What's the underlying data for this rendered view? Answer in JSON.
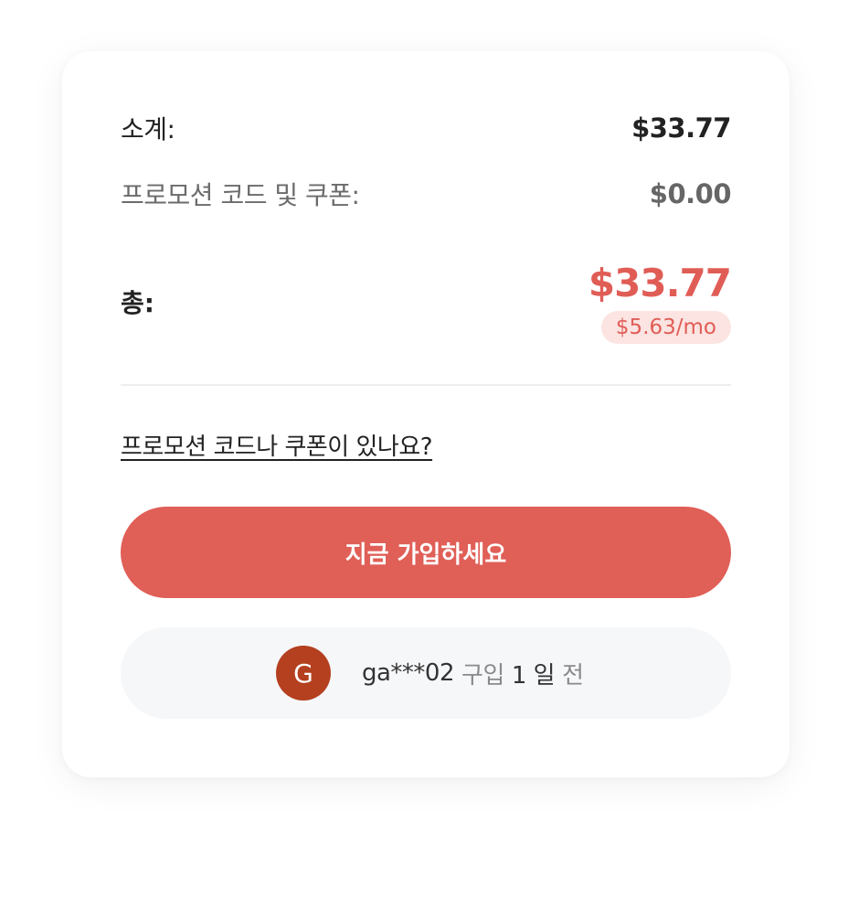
{
  "summary": {
    "subtotal_label": "소계:",
    "subtotal_value": "$33.77",
    "promo_label": "프로모션 코드 및 쿠폰:",
    "promo_value": "$0.00",
    "total_label": "총:",
    "total_value": "$33.77",
    "monthly_value": "$5.63/mo"
  },
  "promo_link": "프로모션 코드나 쿠폰이 있나요?",
  "signup_button": "지금 가입하세요",
  "recent_purchase": {
    "avatar_letter": "G",
    "user": "ga***02",
    "verb": "구입",
    "time_value": "1 일",
    "time_suffix": "전"
  },
  "colors": {
    "accent": "#e05f57",
    "avatar": "#b4401f",
    "badge_bg": "#fbe4e2"
  }
}
